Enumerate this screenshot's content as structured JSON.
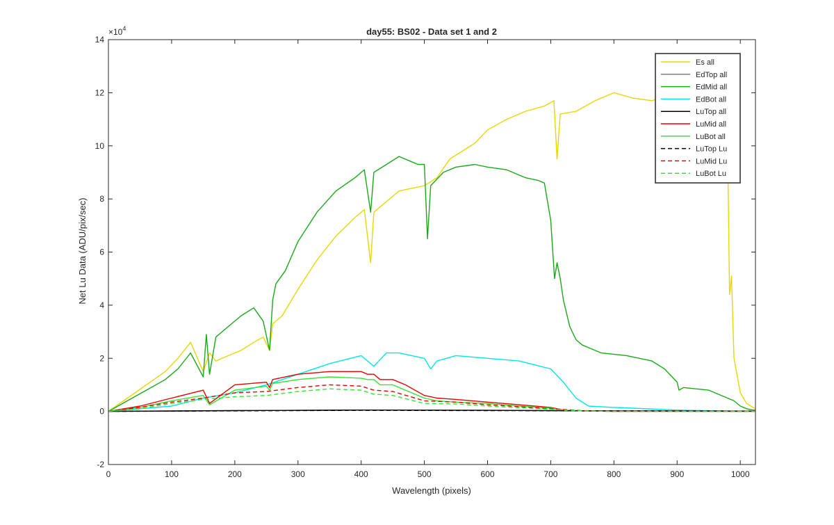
{
  "chart_data": {
    "type": "line",
    "title": "day55: BS02 - Data set 1 and 2",
    "xlabel": "Wavelength (pixels)",
    "ylabel": "Net Lu Data (ADU/pix/sec)",
    "exponent_label": "×10",
    "exponent_power": "4",
    "xlim": [
      0,
      1024
    ],
    "ylim": [
      -2,
      14
    ],
    "y_units": "x10^4",
    "xticks": [
      0,
      100,
      200,
      300,
      400,
      500,
      600,
      700,
      800,
      900,
      1000
    ],
    "yticks": [
      -2,
      0,
      2,
      4,
      6,
      8,
      10,
      12,
      14
    ],
    "grid": false,
    "legend_position": "top-right",
    "series": [
      {
        "name": "Es  all",
        "color": "#e6d800",
        "dash": "solid",
        "x": [
          0,
          30,
          60,
          90,
          110,
          130,
          150,
          160,
          170,
          190,
          210,
          230,
          245,
          255,
          260,
          275,
          300,
          330,
          360,
          390,
          405,
          415,
          420,
          440,
          460,
          480,
          500,
          520,
          540,
          560,
          580,
          600,
          630,
          660,
          690,
          705,
          710,
          715,
          740,
          770,
          800,
          830,
          860,
          900,
          940,
          970,
          980,
          983,
          986,
          990,
          1000,
          1010,
          1020,
          1024
        ],
        "y": [
          0,
          0.5,
          1,
          1.5,
          2,
          2.6,
          1.5,
          2.2,
          1.9,
          2.1,
          2.3,
          2.6,
          2.8,
          2.3,
          3.3,
          3.6,
          4.6,
          5.7,
          6.6,
          7.3,
          7.6,
          5.6,
          7.5,
          7.9,
          8.3,
          8.4,
          8.5,
          8.8,
          9.5,
          9.8,
          10.1,
          10.6,
          11,
          11.3,
          11.5,
          11.7,
          9.5,
          11.2,
          11.3,
          11.7,
          12,
          11.8,
          11.7,
          12,
          11.5,
          11.3,
          10,
          4.4,
          5.1,
          2,
          0.7,
          0.3,
          0.15,
          0.1
        ]
      },
      {
        "name": "EdTop  all",
        "color": "#808080",
        "dash": "solid",
        "x": [
          0,
          200,
          400,
          600,
          800,
          1024
        ],
        "y": [
          0,
          0.03,
          0.05,
          0.04,
          0.02,
          0.01
        ]
      },
      {
        "name": "EdMid  all",
        "color": "#1aa81a",
        "dash": "solid",
        "x": [
          0,
          30,
          60,
          90,
          110,
          130,
          150,
          155,
          160,
          170,
          190,
          210,
          230,
          245,
          255,
          260,
          265,
          280,
          300,
          330,
          360,
          390,
          405,
          415,
          420,
          440,
          460,
          480,
          490,
          500,
          505,
          510,
          530,
          550,
          580,
          600,
          630,
          660,
          680,
          690,
          700,
          706,
          710,
          715,
          720,
          730,
          740,
          750,
          760,
          780,
          820,
          860,
          880,
          900,
          903,
          910,
          950,
          990,
          1000,
          1010,
          1020,
          1024
        ],
        "y": [
          0,
          0.4,
          0.8,
          1.2,
          1.6,
          2.2,
          1.3,
          2.9,
          1.4,
          2.8,
          3.2,
          3.6,
          3.9,
          3.4,
          2.3,
          4.2,
          4.8,
          5.3,
          6.4,
          7.5,
          8.3,
          8.8,
          9.1,
          7.5,
          9,
          9.3,
          9.6,
          9.4,
          9.3,
          9.3,
          6.5,
          8.5,
          9,
          9.2,
          9.3,
          9.2,
          9.1,
          8.8,
          8.7,
          8.6,
          7.2,
          5,
          5.6,
          5,
          4.2,
          3.2,
          2.7,
          2.5,
          2.4,
          2.2,
          2.1,
          1.9,
          1.6,
          1.1,
          0.8,
          0.9,
          0.8,
          0.4,
          0.2,
          0.1,
          0.05,
          0.05
        ]
      },
      {
        "name": "EdBot  all",
        "color": "#00e6e6",
        "dash": "solid",
        "x": [
          0,
          100,
          150,
          200,
          250,
          300,
          350,
          400,
          420,
          440,
          460,
          480,
          500,
          510,
          520,
          550,
          600,
          650,
          700,
          720,
          740,
          760,
          800,
          900,
          1000,
          1024
        ],
        "y": [
          0,
          0.2,
          0.5,
          0.7,
          1,
          1.4,
          1.8,
          2.1,
          1.7,
          2.2,
          2.2,
          2.1,
          2,
          1.6,
          1.9,
          2.1,
          2,
          1.9,
          1.6,
          1.1,
          0.5,
          0.2,
          0.15,
          0.05,
          0,
          0
        ]
      },
      {
        "name": "LuTop  all",
        "color": "#000000",
        "dash": "solid",
        "x": [
          0,
          200,
          400,
          600,
          800,
          1024
        ],
        "y": [
          0,
          0.03,
          0.05,
          0.04,
          0.02,
          0.01
        ]
      },
      {
        "name": "LuMid  all",
        "color": "#e60000",
        "dash": "solid",
        "x": [
          0,
          50,
          100,
          150,
          160,
          200,
          250,
          255,
          260,
          300,
          350,
          400,
          410,
          420,
          430,
          450,
          470,
          500,
          520,
          550,
          600,
          650,
          700,
          720,
          750,
          800,
          1024
        ],
        "y": [
          0,
          0.2,
          0.5,
          0.8,
          0.3,
          1,
          1.1,
          0.9,
          1.2,
          1.4,
          1.5,
          1.5,
          1.4,
          1.4,
          1.2,
          1.2,
          1,
          0.6,
          0.5,
          0.45,
          0.35,
          0.25,
          0.15,
          0.05,
          0.02,
          0,
          0
        ]
      },
      {
        "name": "LuBot  all",
        "color": "#33e633",
        "dash": "solid",
        "x": [
          0,
          50,
          100,
          150,
          160,
          200,
          250,
          255,
          260,
          300,
          350,
          400,
          410,
          420,
          430,
          450,
          470,
          500,
          520,
          550,
          600,
          650,
          700,
          720,
          750,
          800,
          1024
        ],
        "y": [
          0,
          0.15,
          0.4,
          0.6,
          0.25,
          0.8,
          0.95,
          0.8,
          1.05,
          1.2,
          1.3,
          1.25,
          1.2,
          1.2,
          1,
          1,
          0.8,
          0.5,
          0.4,
          0.35,
          0.3,
          0.2,
          0.12,
          0.04,
          0.02,
          0,
          0
        ]
      },
      {
        "name": "LuTop  Lu",
        "color": "#000000",
        "dash": "dashed",
        "x": [
          0,
          200,
          400,
          600,
          800,
          1024
        ],
        "y": [
          0,
          0.02,
          0.04,
          0.03,
          0.02,
          0.01
        ]
      },
      {
        "name": "LuMid  Lu",
        "color": "#e60000",
        "dash": "dashed",
        "x": [
          0,
          50,
          100,
          150,
          200,
          250,
          300,
          350,
          400,
          420,
          450,
          500,
          550,
          600,
          650,
          700,
          750,
          800,
          1024
        ],
        "y": [
          0,
          0.15,
          0.35,
          0.5,
          0.7,
          0.75,
          0.9,
          1,
          0.95,
          0.8,
          0.75,
          0.4,
          0.35,
          0.25,
          0.18,
          0.1,
          0.03,
          0,
          0
        ]
      },
      {
        "name": "LuBot  Lu",
        "color": "#33e633",
        "dash": "dashed",
        "x": [
          0,
          50,
          100,
          150,
          200,
          250,
          300,
          350,
          400,
          420,
          450,
          500,
          550,
          600,
          650,
          700,
          750,
          800,
          1024
        ],
        "y": [
          0,
          0.1,
          0.3,
          0.45,
          0.55,
          0.6,
          0.75,
          0.85,
          0.8,
          0.65,
          0.6,
          0.3,
          0.28,
          0.2,
          0.14,
          0.08,
          0.02,
          0,
          0
        ]
      }
    ]
  }
}
